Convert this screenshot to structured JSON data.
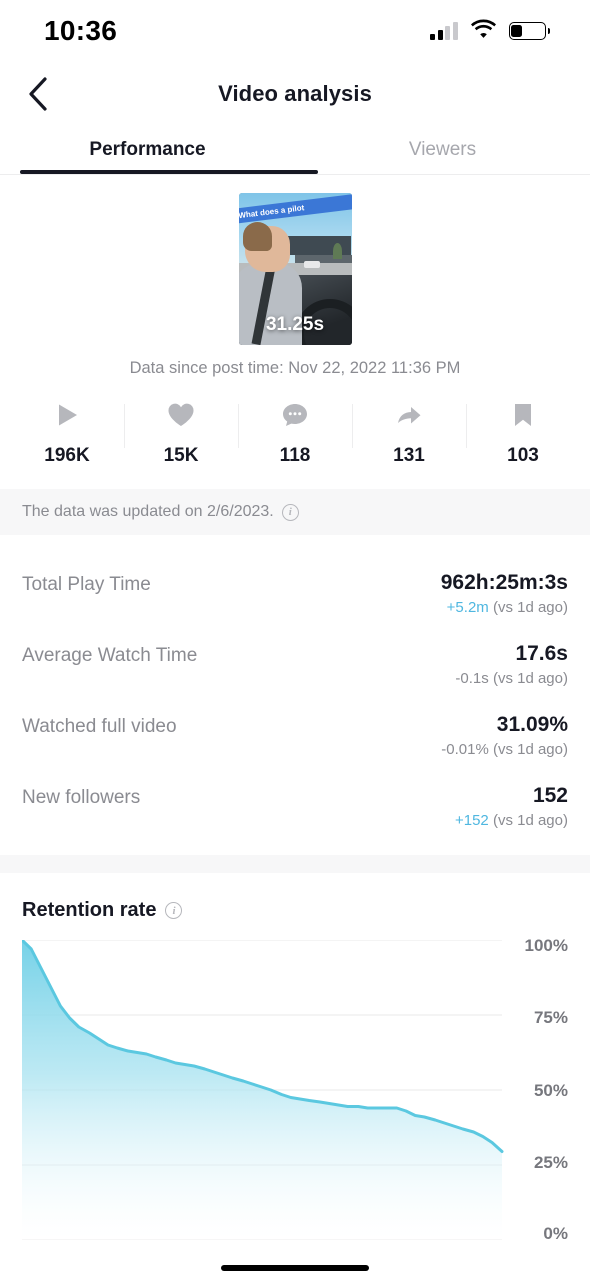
{
  "status_bar": {
    "time": "10:36",
    "signal_icon": "cellular-signal-icon",
    "wifi_icon": "wifi-icon",
    "battery_icon": "battery-icon",
    "battery_level": 35
  },
  "nav": {
    "back_icon": "chevron-left-icon",
    "title": "Video analysis"
  },
  "tabs": [
    {
      "label": "Performance",
      "active": true
    },
    {
      "label": "Viewers",
      "active": false
    }
  ],
  "video": {
    "caption_overlay": "What does a pilot",
    "duration": "31.25s",
    "since_text": "Data since post time: Nov 22, 2022 11:36 PM"
  },
  "engagement": [
    {
      "icon": "play-icon",
      "name": "plays",
      "value": "196K"
    },
    {
      "icon": "heart-icon",
      "name": "likes",
      "value": "15K"
    },
    {
      "icon": "comment-icon",
      "name": "comments",
      "value": "118"
    },
    {
      "icon": "share-icon",
      "name": "shares",
      "value": "131"
    },
    {
      "icon": "bookmark-icon",
      "name": "saves",
      "value": "103"
    }
  ],
  "update_banner": {
    "text": "The data was updated on 2/6/2023.",
    "info_icon": "info-icon",
    "info_glyph": "i"
  },
  "metrics": [
    {
      "label": "Total Play Time",
      "value": "962h:25m:3s",
      "delta": "+5.2m",
      "delta_direction": "up",
      "delta_suffix": " (vs 1d ago)"
    },
    {
      "label": "Average Watch Time",
      "value": "17.6s",
      "delta": "-0.1s",
      "delta_direction": "down",
      "delta_suffix": " (vs 1d ago)"
    },
    {
      "label": "Watched full video",
      "value": "31.09%",
      "delta": "-0.01%",
      "delta_direction": "down",
      "delta_suffix": " (vs 1d ago)"
    },
    {
      "label": "New followers",
      "value": "152",
      "delta": "+152",
      "delta_direction": "up",
      "delta_suffix": " (vs 1d ago)"
    }
  ],
  "retention": {
    "title": "Retention rate",
    "info_icon": "info-icon",
    "info_glyph": "i"
  },
  "colors": {
    "accent_blue": "#4fb7e0",
    "chart_line": "#5bc8e0",
    "text_primary": "#161823",
    "text_secondary": "#8a8b91",
    "divider": "#ededee",
    "panel_bg": "#f7f7f8"
  },
  "chart_data": {
    "type": "area",
    "title": "Retention rate",
    "xlabel": "",
    "ylabel": "",
    "ylim": [
      0,
      100
    ],
    "xlim": [
      0,
      31.25
    ],
    "grid": true,
    "legend": null,
    "ytick_labels": [
      "100%",
      "75%",
      "50%",
      "25%",
      "0%"
    ],
    "ytick_values": [
      100,
      75,
      50,
      25,
      0
    ],
    "series": [
      {
        "name": "Retention rate",
        "x": [
          0,
          0.6,
          1.2,
          1.9,
          2.5,
          3.1,
          3.7,
          4.4,
          5.0,
          5.6,
          6.2,
          6.9,
          7.5,
          8.1,
          8.7,
          9.4,
          10.0,
          10.6,
          11.2,
          11.9,
          12.5,
          13.1,
          13.7,
          14.4,
          15.0,
          15.6,
          16.2,
          16.9,
          17.5,
          18.1,
          18.7,
          19.4,
          20.0,
          20.6,
          21.2,
          21.9,
          22.5,
          23.1,
          23.7,
          24.4,
          25.0,
          25.6,
          26.2,
          26.9,
          27.5,
          28.1,
          28.7,
          29.4,
          30.0,
          30.6,
          31.25
        ],
        "values": [
          100,
          97,
          91,
          84,
          78,
          74,
          71,
          69,
          67,
          65,
          64,
          63,
          62.5,
          62,
          61,
          60,
          59,
          58.5,
          58,
          57,
          56,
          55,
          54,
          53,
          52,
          51,
          50,
          48.5,
          47.5,
          47,
          46.5,
          46,
          45.5,
          45,
          44.5,
          44.5,
          44,
          44,
          44,
          44,
          43,
          41.5,
          41,
          40,
          39,
          38,
          37,
          36,
          34.5,
          32.5,
          29.5
        ]
      }
    ]
  }
}
